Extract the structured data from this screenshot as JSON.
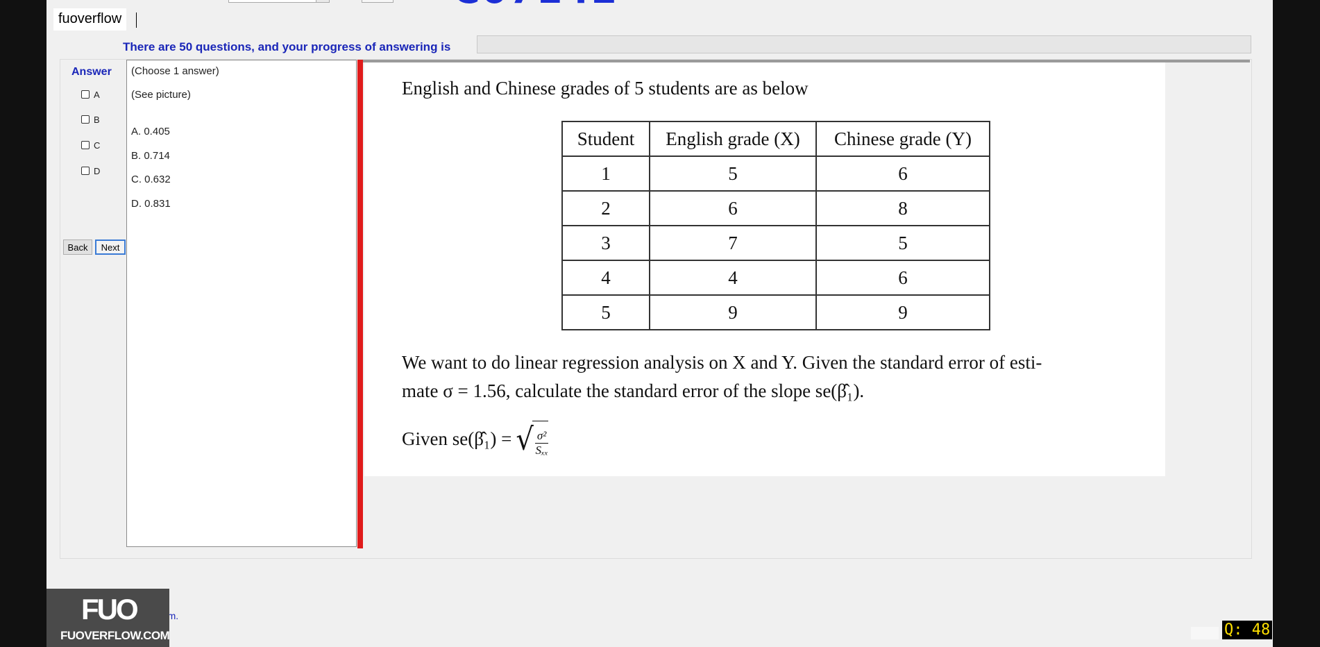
{
  "header": {
    "brand": "fuoverflow",
    "progress_label": "There are 50 questions, and your progress of answering is",
    "progress_fraction": 0
  },
  "answer_panel": {
    "label": "Answer",
    "options": [
      "A",
      "B",
      "C",
      "D"
    ],
    "back_label": "Back",
    "next_label": "Next"
  },
  "question": {
    "instruction": "(Choose 1 answer)",
    "hint": "(See picture)",
    "choices": [
      "A. 0.405",
      "B. 0.714",
      "C. 0.632",
      "D. 0.831"
    ]
  },
  "picture": {
    "intro": "English and Chinese grades of 5 students are as below",
    "table_headers": [
      "Student",
      "English grade (X)",
      "Chinese grade (Y)"
    ],
    "table_rows": [
      [
        "1",
        "5",
        "6"
      ],
      [
        "2",
        "6",
        "8"
      ],
      [
        "3",
        "7",
        "5"
      ],
      [
        "4",
        "4",
        "6"
      ],
      [
        "5",
        "9",
        "9"
      ]
    ],
    "para_line1": "We want to do linear regression analysis on X and Y. Given the standard error of esti-",
    "para_line2": "mate σ = 1.56, calculate the standard error of the slope se(β̂₁).",
    "formula_prefix": "Given se(β̂₁) =",
    "formula_num": "σ²",
    "formula_den": "Sₓₓ"
  },
  "footer": {
    "finish_label": "sh the exam.",
    "watermark_logo": "FUO",
    "watermark_site": "FUOVERFLOW.COM",
    "question_counter": "Q: 48"
  }
}
